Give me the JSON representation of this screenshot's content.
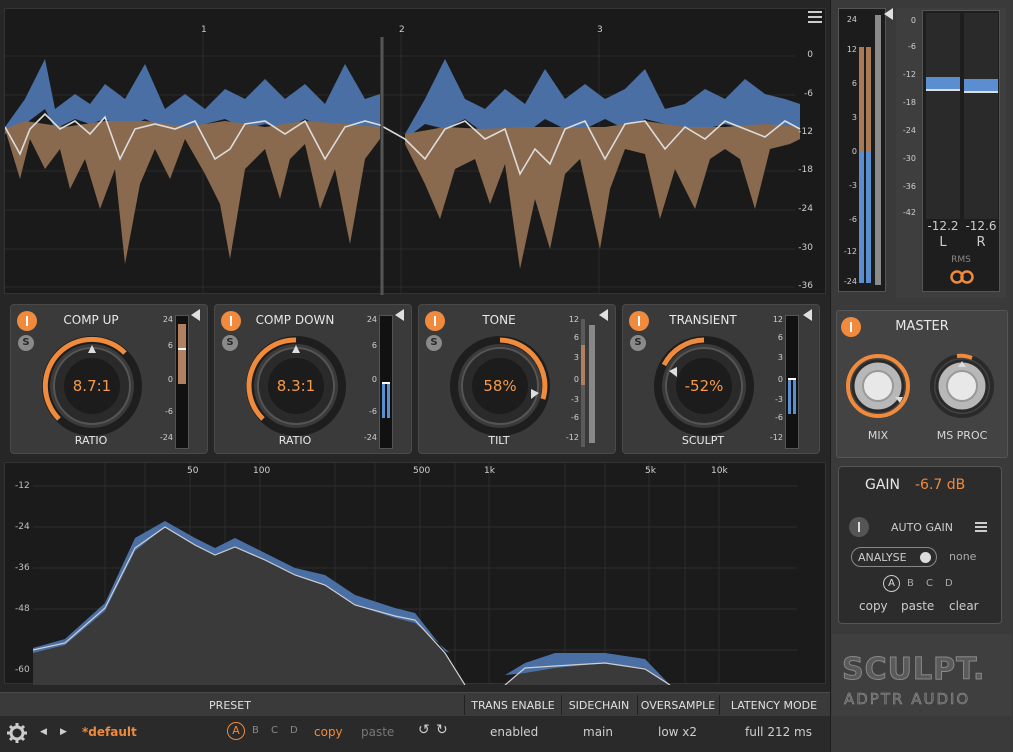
{
  "waveform": {
    "bar_markers": [
      "1",
      "2",
      "3"
    ],
    "db_scale": [
      "0",
      "-6",
      "-12",
      "-18",
      "-24",
      "-30",
      "-36"
    ],
    "menu_icon": "hamburger-menu-icon"
  },
  "modules": [
    {
      "title": "COMP UP",
      "value": "8.7:1",
      "sub": "RATIO",
      "scale": [
        "24",
        "6",
        "0",
        "-6",
        "-24"
      ],
      "meter_color": "#b08060"
    },
    {
      "title": "COMP DOWN",
      "value": "8.3:1",
      "sub": "RATIO",
      "scale": [
        "24",
        "6",
        "0",
        "-6",
        "-24"
      ],
      "meter_color": "#5a8ed0"
    },
    {
      "title": "TONE",
      "value": "58%",
      "sub": "TILT",
      "scale": [
        "12",
        "6",
        "3",
        "0",
        "-3",
        "-6",
        "-12"
      ],
      "meter_color": "#b08060"
    },
    {
      "title": "TRANSIENT",
      "value": "-52%",
      "sub": "SCULPT",
      "scale": [
        "12",
        "6",
        "3",
        "0",
        "-3",
        "-6",
        "-12"
      ],
      "meter_color": "#5a8ed0"
    }
  ],
  "eq": {
    "freq_labels": [
      "50",
      "100",
      "500",
      "1k",
      "5k",
      "10k"
    ],
    "db_labels": [
      "-12",
      "-24",
      "-36",
      "-48",
      "-60"
    ]
  },
  "labels_bar": {
    "preset": "PRESET",
    "trans_enable": "TRANS ENABLE",
    "sidechain": "SIDECHAIN",
    "oversample": "OVERSAMPLE",
    "latency_mode": "LATENCY MODE"
  },
  "status": {
    "preset_name": "*default",
    "slots": [
      "A",
      "B",
      "C",
      "D"
    ],
    "copy": "copy",
    "paste": "paste",
    "trans_enable": "enabled",
    "sidechain": "main",
    "oversample": "low x2",
    "latency": "full 212 ms"
  },
  "right_meter": {
    "scale": [
      "24",
      "12",
      "6",
      "3",
      "0",
      "-3",
      "-6",
      "-12",
      "-24"
    ]
  },
  "output_meter": {
    "scale": [
      "0",
      "-6",
      "-12",
      "-18",
      "-24",
      "-30",
      "-36",
      "-42"
    ],
    "left_value": "-12.2",
    "right_value": "-12.6",
    "left_label": "L",
    "right_label": "R",
    "rms_label": "RMS",
    "link_icon": "link-rings-icon"
  },
  "master": {
    "title": "MASTER",
    "mix_label": "MIX",
    "msproc_label": "MS PROC"
  },
  "gain": {
    "label": "GAIN",
    "value": "-6.7 dB",
    "auto_gain": "AUTO GAIN",
    "analyse": "ANALYSE",
    "analyse_state": "none",
    "slots": [
      "A",
      "B",
      "C",
      "D"
    ],
    "copy": "copy",
    "paste": "paste",
    "clear": "clear"
  },
  "brand": {
    "product": "SCULPT.",
    "company": "ADPTR AUDIO"
  },
  "colors": {
    "accent": "#f08a3c",
    "blue": "#4a6fa5",
    "brown": "#8a6a4f"
  }
}
